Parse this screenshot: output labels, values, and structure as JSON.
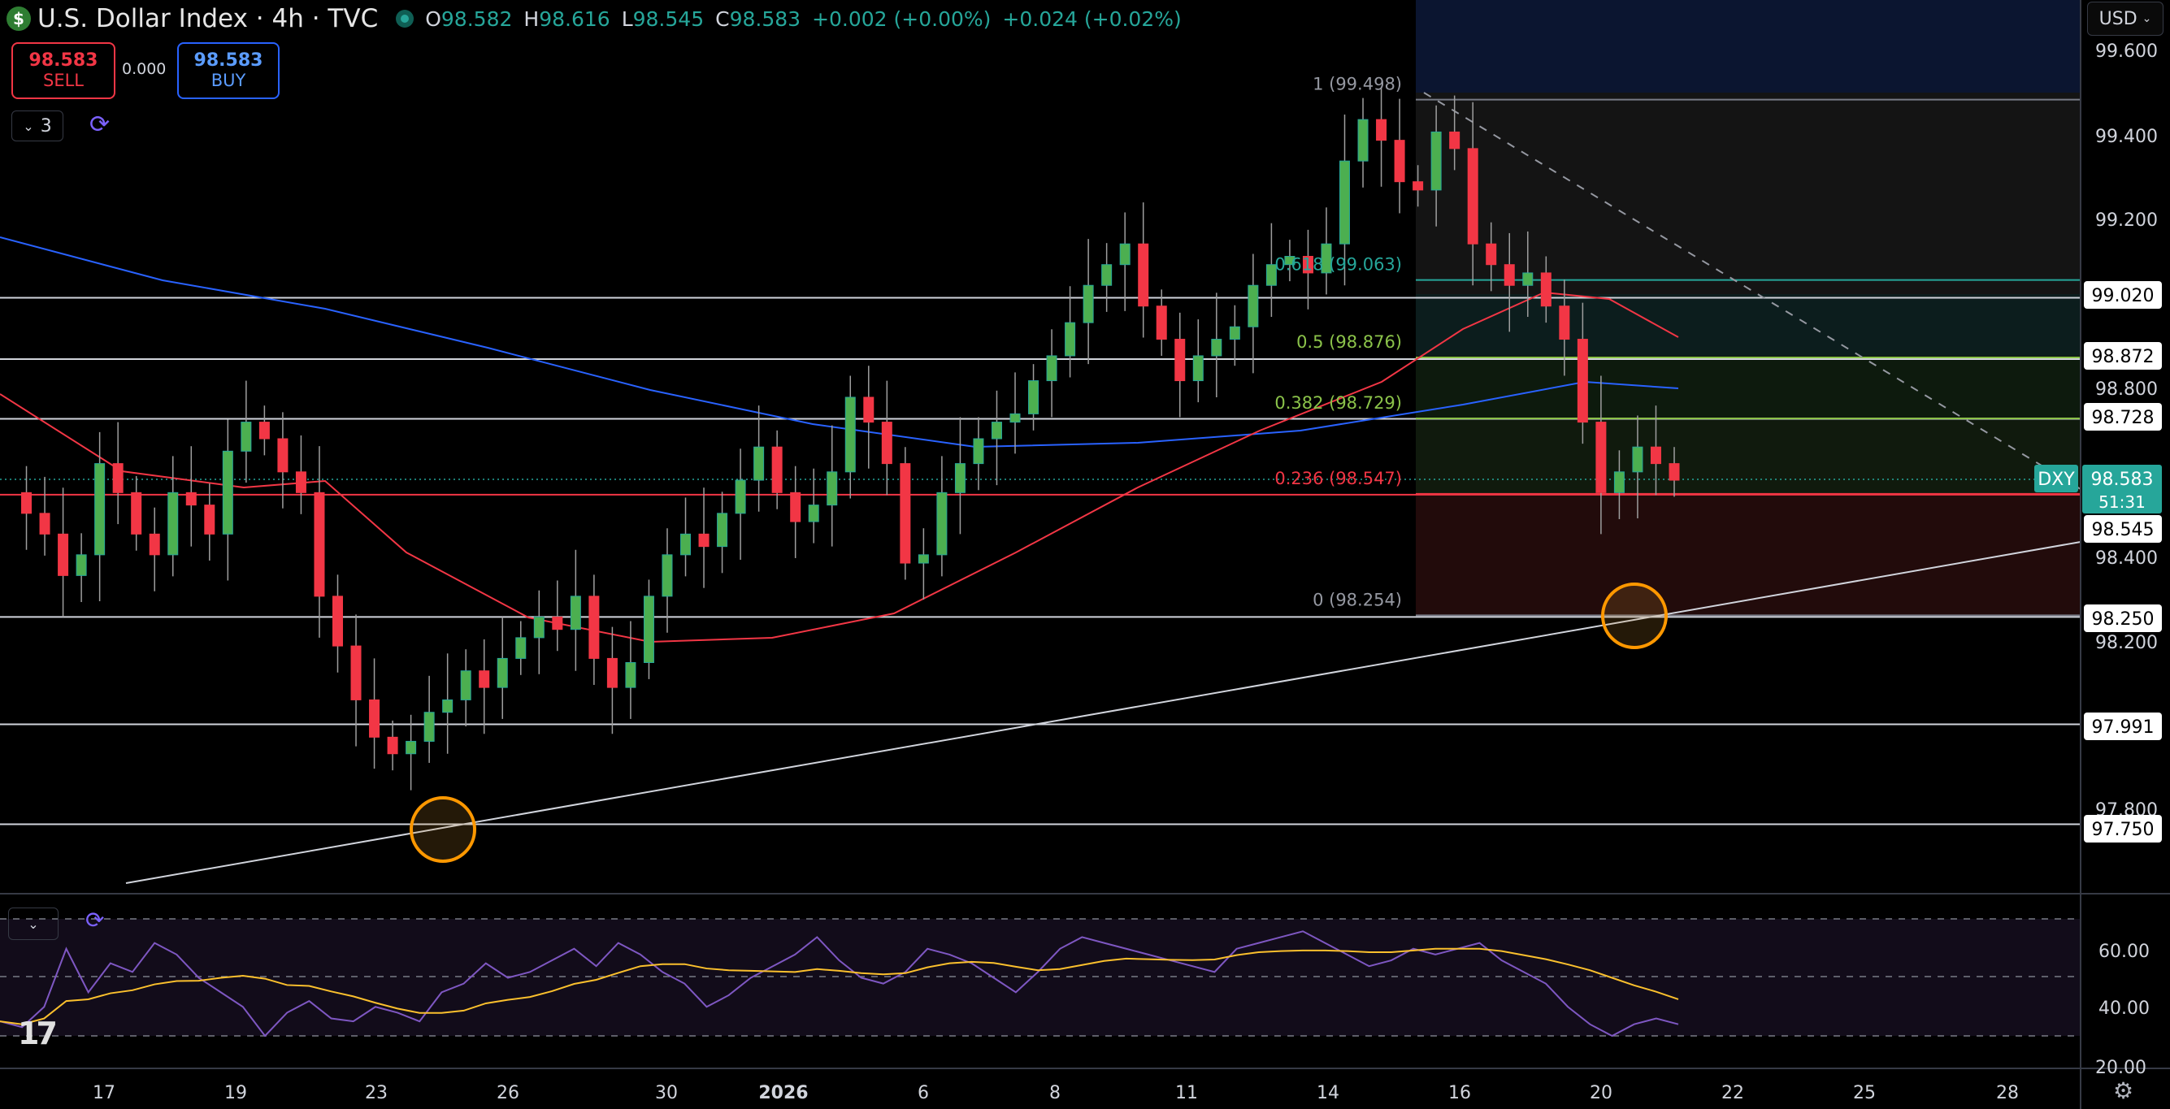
{
  "header": {
    "title": "U.S. Dollar Index · 4h · TVC",
    "ohlc": [
      {
        "k": "O",
        "v": "98.582"
      },
      {
        "k": "H",
        "v": "98.616"
      },
      {
        "k": "L",
        "v": "98.545"
      },
      {
        "k": "C",
        "v": "98.583"
      }
    ],
    "change": "+0.002 (+0.00%)",
    "change2": "+0.024 (+0.02%)"
  },
  "trade": {
    "sell_price": "98.583",
    "sell_label": "SELL",
    "spread": "0.000",
    "buy_price": "98.583",
    "buy_label": "BUY"
  },
  "indicator_count": "3",
  "currency": "USD",
  "price_axis": {
    "ticks": [
      "99.600",
      "99.400",
      "99.200",
      "98.800",
      "98.400",
      "98.200",
      "97.800",
      "20.00"
    ],
    "level_labels": [
      "99.020",
      "98.872",
      "98.728",
      "98.545",
      "98.250",
      "97.991",
      "97.750"
    ],
    "symbol_tag": "DXY",
    "last_price": "98.583",
    "countdown": "51:31"
  },
  "rsi_axis": [
    "60.00",
    "40.00"
  ],
  "time_axis": [
    "17",
    "19",
    "23",
    "26",
    "30",
    "2026",
    "6",
    "8",
    "11",
    "14",
    "16",
    "20",
    "22",
    "25",
    "28"
  ],
  "fib_labels": [
    {
      "text": "1 (99.498)",
      "color": "#9598a1"
    },
    {
      "text": "0.618 (99.063)",
      "color": "#26a69a"
    },
    {
      "text": "0.5 (98.876)",
      "color": "#8bc34a"
    },
    {
      "text": "0.382 (98.729)",
      "color": "#8bc34a"
    },
    {
      "text": "0.236 (98.547)",
      "color": "#f23645"
    },
    {
      "text": "0 (98.254)",
      "color": "#9598a1"
    }
  ],
  "colors": {
    "up": "#26a69a",
    "up_body": "#4caf50",
    "down": "#f23645",
    "ema_fast": "#f23645",
    "ema_slow": "#2962ff",
    "rsi": "#7e57c2",
    "rsi_ma": "#fbc02d",
    "highlight": "#ff9800"
  },
  "icons": {
    "logo": "dollar-icon",
    "sync": "sync-icon",
    "chevron": "chevron-down-icon",
    "settings": "gear-icon"
  }
}
